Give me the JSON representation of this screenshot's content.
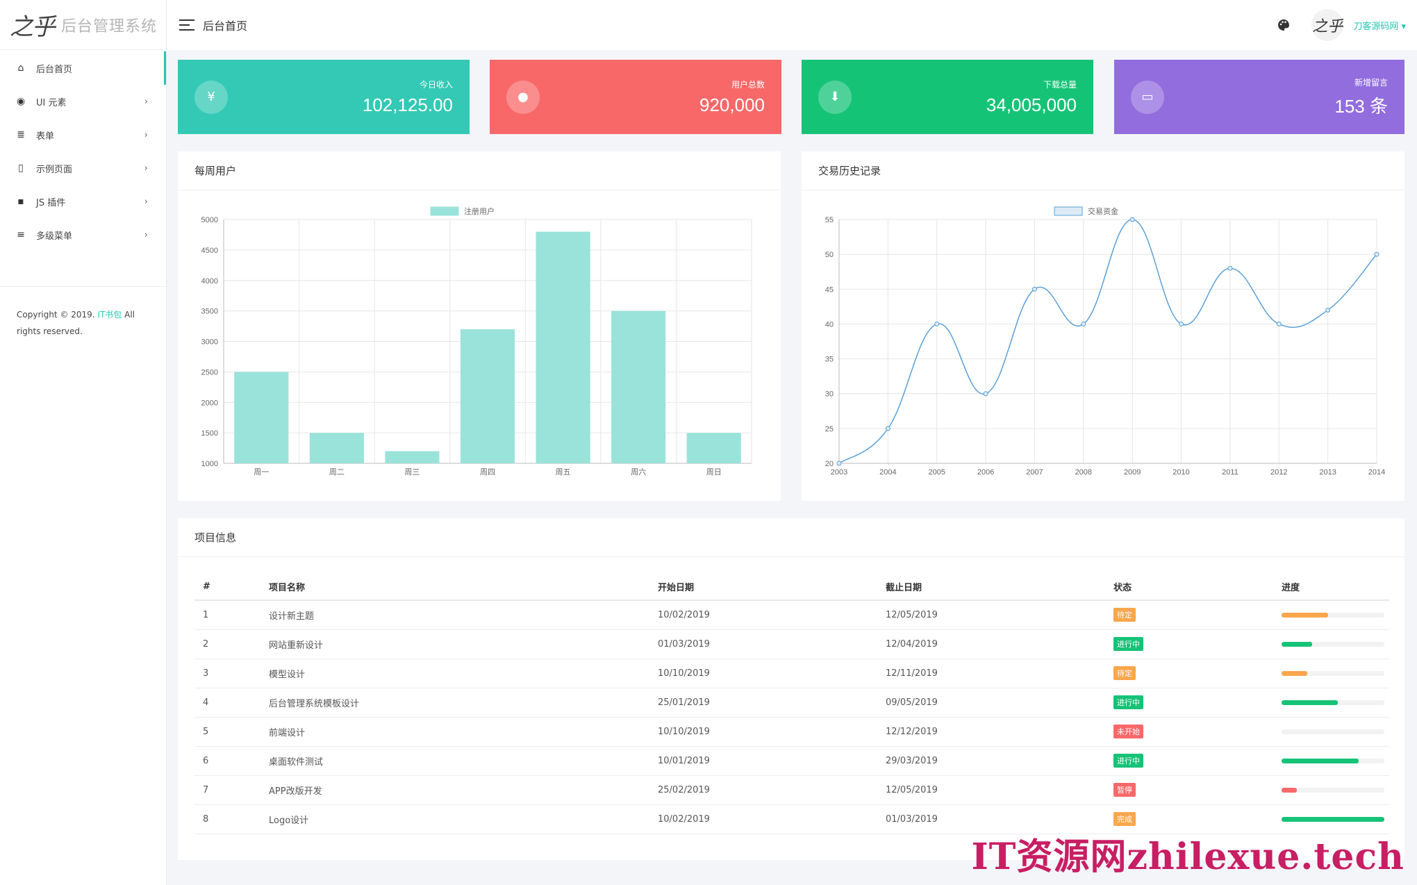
{
  "brand": {
    "logo_text": "后台管理系统",
    "logo_mark": "之乎"
  },
  "topbar": {
    "title": "后台首页",
    "user": "刀客源码网",
    "avatar_text": "之乎"
  },
  "sidebar": {
    "items": [
      {
        "label": "后台首页",
        "icon": "home-icon",
        "arrow": ""
      },
      {
        "label": "UI 元素",
        "icon": "palette-icon",
        "arrow": "›"
      },
      {
        "label": "表单",
        "icon": "list-icon",
        "arrow": "›"
      },
      {
        "label": "示例页面",
        "icon": "file-icon",
        "arrow": "›"
      },
      {
        "label": "JS 插件",
        "icon": "js-icon",
        "arrow": "›"
      },
      {
        "label": "多级菜单",
        "icon": "menu-icon",
        "arrow": "›"
      }
    ],
    "copyright_pre": "Copyright © 2019. ",
    "copyright_link": "IT书包",
    "copyright_post": " All rights reserved."
  },
  "stats": [
    {
      "label": "今日收入",
      "value": "102,125.00",
      "icon": "yen-icon",
      "glyph": "¥",
      "color": "#33c9b5"
    },
    {
      "label": "用户总数",
      "value": "920,000",
      "icon": "user-icon",
      "glyph": "●",
      "color": "#f96868"
    },
    {
      "label": "下载总量",
      "value": "34,005,000",
      "icon": "download-icon",
      "glyph": "⬇",
      "color": "#15c377"
    },
    {
      "label": "新增留言",
      "value": "153 条",
      "icon": "message-icon",
      "glyph": "▭",
      "color": "#926dde"
    }
  ],
  "panels": {
    "weekly_title": "每周用户",
    "history_title": "交易历史记录",
    "projects_title": "项目信息"
  },
  "chart_data": [
    {
      "type": "bar",
      "categories": [
        "周一",
        "周二",
        "周三",
        "周四",
        "周五",
        "周六",
        "周日"
      ],
      "series": [
        {
          "name": "注册用户",
          "values": [
            2500,
            1500,
            1200,
            3200,
            4800,
            3500,
            1500
          ]
        }
      ],
      "ylim": [
        1000,
        5000
      ],
      "yticks": [
        1000,
        1500,
        2000,
        2500,
        3000,
        3500,
        4000,
        4500,
        5000
      ],
      "color": "#9ae3da",
      "grid": true,
      "legend": "top"
    },
    {
      "type": "line",
      "x": [
        2003,
        2004,
        2005,
        2006,
        2007,
        2008,
        2009,
        2010,
        2011,
        2012,
        2013,
        2014
      ],
      "series": [
        {
          "name": "交易资金",
          "values": [
            20,
            25,
            40,
            30,
            45,
            40,
            55,
            40,
            48,
            40,
            42,
            50
          ]
        }
      ],
      "ylim": [
        20,
        55
      ],
      "yticks": [
        20,
        25,
        30,
        35,
        40,
        45,
        50,
        55
      ],
      "color": "#5a9fd6",
      "grid": true,
      "legend": "top"
    }
  ],
  "table": {
    "headers": [
      "#",
      "项目名称",
      "开始日期",
      "截止日期",
      "状态",
      "进度"
    ],
    "rows": [
      {
        "no": "1",
        "name": "设计新主题",
        "start": "10/02/2019",
        "end": "12/05/2019",
        "status": "待定",
        "status_color": "#faa64b",
        "progress": 0.45,
        "progress_color": "#faa64b"
      },
      {
        "no": "2",
        "name": "网站重新设计",
        "start": "01/03/2019",
        "end": "12/04/2019",
        "status": "进行中",
        "status_color": "#15c377",
        "progress": 0.3,
        "progress_color": "#15c377"
      },
      {
        "no": "3",
        "name": "模型设计",
        "start": "10/10/2019",
        "end": "12/11/2019",
        "status": "待定",
        "status_color": "#faa64b",
        "progress": 0.25,
        "progress_color": "#faa64b"
      },
      {
        "no": "4",
        "name": "后台管理系统模板设计",
        "start": "25/01/2019",
        "end": "09/05/2019",
        "status": "进行中",
        "status_color": "#15c377",
        "progress": 0.55,
        "progress_color": "#15c377"
      },
      {
        "no": "5",
        "name": "前端设计",
        "start": "10/10/2019",
        "end": "12/12/2019",
        "status": "未开始",
        "status_color": "#f96868",
        "progress": 0,
        "progress_color": "#f96868"
      },
      {
        "no": "6",
        "name": "桌面软件测试",
        "start": "10/01/2019",
        "end": "29/03/2019",
        "status": "进行中",
        "status_color": "#15c377",
        "progress": 0.75,
        "progress_color": "#15c377"
      },
      {
        "no": "7",
        "name": "APP改版开发",
        "start": "25/02/2019",
        "end": "12/05/2019",
        "status": "暂停",
        "status_color": "#f96868",
        "progress": 0.15,
        "progress_color": "#f96868"
      },
      {
        "no": "8",
        "name": "Logo设计",
        "start": "10/02/2019",
        "end": "01/03/2019",
        "status": "完成",
        "status_color": "#faa64b",
        "progress": 1.0,
        "progress_color": "#15c377"
      }
    ]
  },
  "watermark": "IT资源网zhilexue.tech"
}
